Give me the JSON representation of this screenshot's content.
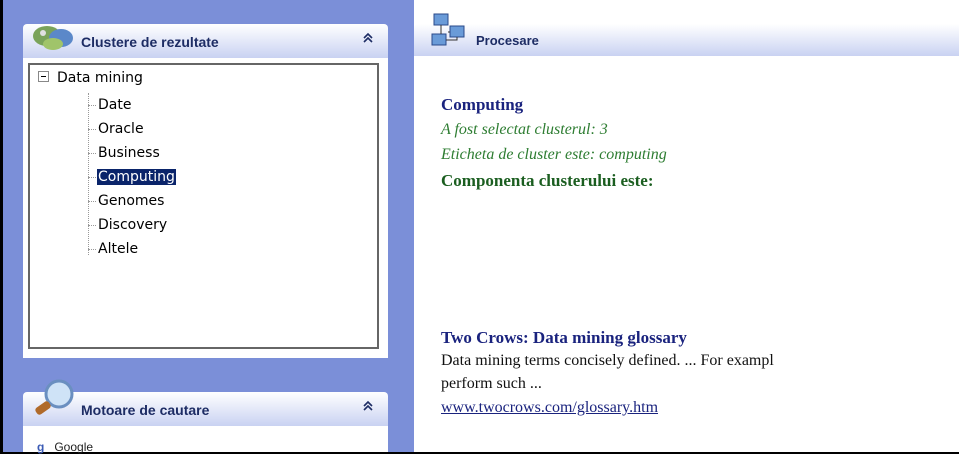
{
  "clusters_panel": {
    "title": "Clustere de rezultate",
    "collapse_glyph": "⌃",
    "icon": "clusters-icon",
    "tree": {
      "root": "Data mining",
      "items": [
        "Date",
        "Oracle",
        "Business",
        "Computing",
        "Genomes",
        "Discovery",
        "Altele"
      ],
      "selected": "Computing"
    }
  },
  "search_panel": {
    "title": "Motoare de cautare",
    "collapse_glyph": "⌃",
    "icon": "magnifier-icon",
    "engines": [
      {
        "icon": "g",
        "label": "Google"
      }
    ]
  },
  "processing_panel": {
    "title": "Procesare",
    "icon": "network-icon",
    "cluster_title": "Computing",
    "selected_text": "A fost selectat clusterul: 3",
    "label_text": "Eticheta de cluster este: computing",
    "component_text": "Componenta clusterului este:",
    "results": [
      {
        "title": "Two Crows: Data mining glossary",
        "desc_line1": "Data mining terms concisely defined. ... For exampl",
        "desc_line2": "perform such ...",
        "url": "www.twocrows.com/glossary.htm"
      }
    ]
  },
  "colors": {
    "accent": "#0a246a",
    "panel_bg": "#7b8fd8",
    "title_blue": "#1a237e",
    "green": "#2e7d32"
  }
}
